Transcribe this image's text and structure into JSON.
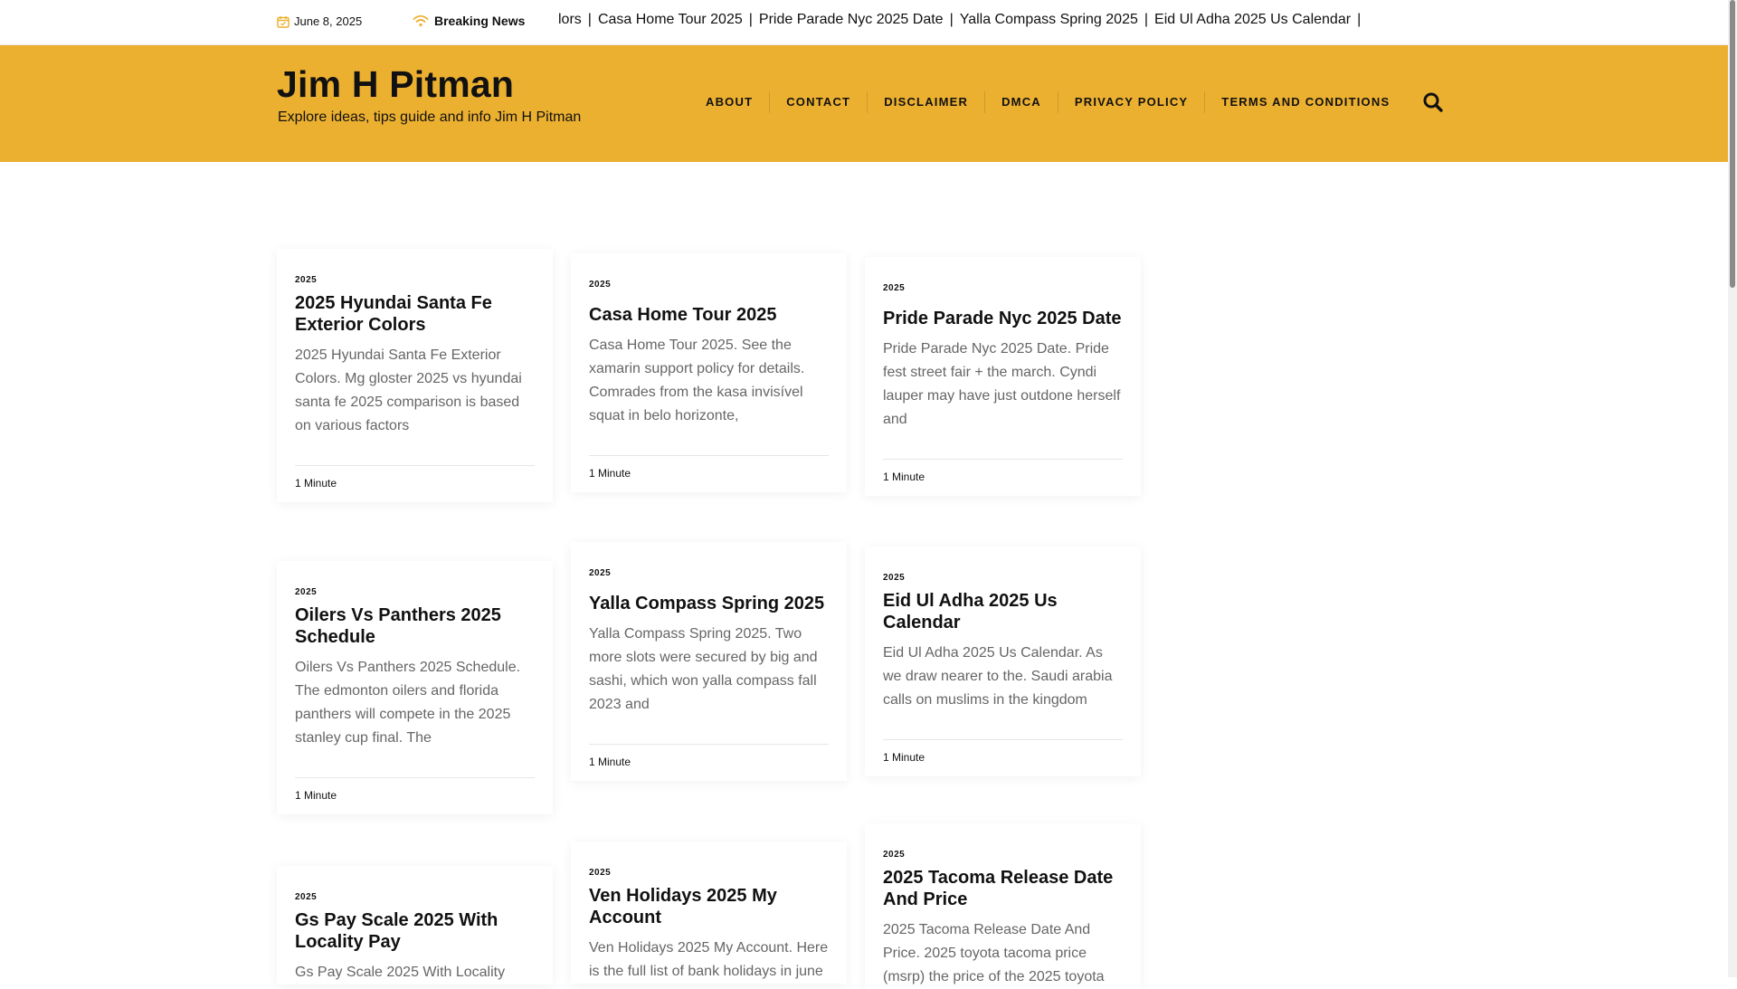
{
  "topbar": {
    "date": "June 8, 2025",
    "breaking_label": "Breaking News",
    "ticker": [
      "lors",
      "Casa Home Tour 2025",
      "Pride Parade Nyc 2025 Date",
      "Yalla Compass Spring 2025",
      "Eid Ul Adha 2025 Us Calendar"
    ],
    "ticker_separator": "|"
  },
  "header": {
    "site_title": "Jim H Pitman",
    "tagline": "Explore ideas, tips guide and info Jim H Pitman",
    "nav": [
      "ABOUT",
      "CONTACT",
      "DISCLAIMER",
      "DMCA",
      "PRIVACY POLICY",
      "TERMS AND CONDITIONS"
    ],
    "search_icon": "search-icon",
    "accent_color": "#ecb030"
  },
  "posts": [
    {
      "category": "2025",
      "title": "2025 Hyundai Santa Fe Exterior Colors",
      "excerpt": "2025 Hyundai Santa Fe Exterior Colors. Mg gloster 2025 vs hyundai santa fe 2025 comparison is based on various factors",
      "read_time": "1 Minute"
    },
    {
      "category": "2025",
      "title": "Casa Home Tour 2025",
      "excerpt": "Casa Home Tour 2025. See the xamarin support policy for details. Comrades from the kasa invisível squat in belo horizonte,",
      "read_time": "1 Minute"
    },
    {
      "category": "2025",
      "title": "Pride Parade Nyc 2025 Date",
      "excerpt": "Pride Parade Nyc 2025 Date. Pride fest street fair + the march. Cyndi lauper may have just outdone herself and",
      "read_time": "1 Minute"
    },
    {
      "category": "2025",
      "title": "Oilers Vs Panthers 2025 Schedule",
      "excerpt": "Oilers Vs Panthers 2025 Schedule. The edmonton oilers and florida panthers will compete in the 2025 stanley cup final. The",
      "read_time": "1 Minute"
    },
    {
      "category": "2025",
      "title": "Yalla Compass Spring 2025",
      "excerpt": "Yalla Compass Spring 2025. Two more slots were secured by big and sashi, which won yalla compass fall 2023 and",
      "read_time": "1 Minute"
    },
    {
      "category": "2025",
      "title": "Eid Ul Adha 2025 Us Calendar",
      "excerpt": "Eid Ul Adha 2025 Us Calendar. As we draw nearer to the. Saudi arabia calls on muslims in the kingdom",
      "read_time": "1 Minute"
    },
    {
      "category": "2025",
      "title": "Gs Pay Scale 2025 With Locality Pay",
      "excerpt": "Gs Pay Scale 2025 With Locality",
      "read_time": ""
    },
    {
      "category": "2025",
      "title": "Ven Holidays 2025 My Account",
      "excerpt": "Ven Holidays 2025 My Account. Here is the full list of bank holidays in june",
      "read_time": ""
    },
    {
      "category": "2025",
      "title": "2025 Tacoma Release Date And Price",
      "excerpt": "2025 Tacoma Release Date And Price. 2025 toyota tacoma price (msrp) the price of the 2025 toyota",
      "read_time": ""
    }
  ]
}
